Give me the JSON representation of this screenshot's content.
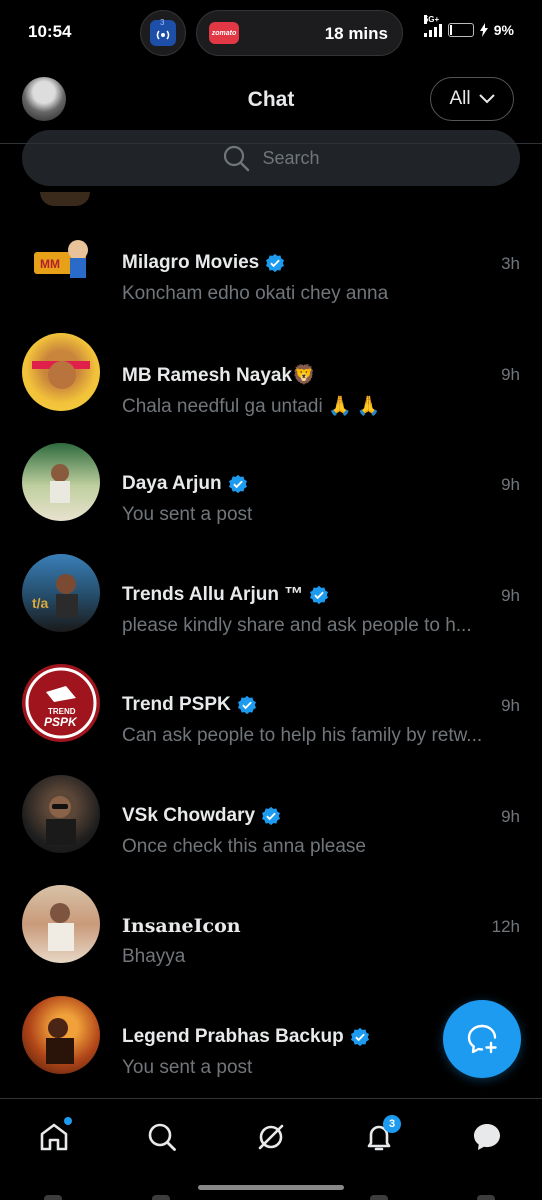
{
  "status_bar": {
    "time": "10:54",
    "notification_count": "3",
    "live_activity_app": "zomato",
    "live_activity_eta": "18 mins",
    "network": "5G+",
    "battery": "9%",
    "battery_level": 0.09
  },
  "header": {
    "title": "Chat",
    "filter_label": "All"
  },
  "search": {
    "placeholder": "Search"
  },
  "chats": [
    {
      "name": "Milagro Movies",
      "verified": true,
      "time": "3h",
      "preview": "Koncham edho okati chey anna"
    },
    {
      "name": "MB Ramesh Nayak🦁",
      "verified": false,
      "time": "9h",
      "preview": "Chala needful ga untadi 🙏 🙏"
    },
    {
      "name": "Daya Arjun",
      "verified": true,
      "time": "9h",
      "preview": "You sent a post"
    },
    {
      "name": "Trends Allu Arjun ™",
      "verified": true,
      "time": "9h",
      "preview": "please kindly share and  ask  people to h..."
    },
    {
      "name": "Trend PSPK",
      "verified": true,
      "time": "9h",
      "preview": "Can ask people to help his family by retw..."
    },
    {
      "name": "VSk Chowdary",
      "verified": true,
      "time": "9h",
      "preview": "Once check this anna please"
    },
    {
      "name": "InsaneIcon",
      "verified": false,
      "time": "12h",
      "preview": "Bhayya"
    },
    {
      "name": "Legend Prabhas Backup",
      "verified": true,
      "time": "",
      "preview": "You sent a post"
    }
  ],
  "bottom_nav": {
    "notifications_badge": "3"
  },
  "colors": {
    "accent": "#1d9bf0",
    "background": "#000000",
    "text_primary": "#e7e9ea",
    "text_secondary": "#71767b"
  }
}
